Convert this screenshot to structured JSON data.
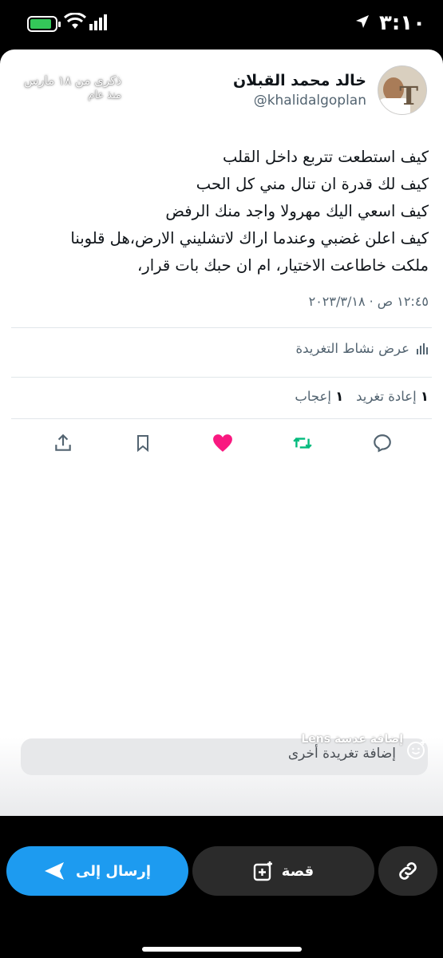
{
  "status_bar": {
    "time": "٣:١٠",
    "battery_color": "#34c759"
  },
  "memory": {
    "line1": "ذكرى من ١٨ مارس",
    "line2": "منذ عام"
  },
  "tweet": {
    "author_name": "خالد محمد القبلان",
    "author_handle": "@khalidalgoplan",
    "lines": [
      "كيف استطعت تتربع داخل القلب",
      "كيف لك قدرة ان تنال مني كل الحب",
      "كيف اسعي اليك مهرولا واجد منك الرفض",
      "كيف اعلن غضبي وعندما اراك لاتشليني الارض،هل قلوبنا",
      "ملكت خاطاعت الاختيار، ام ان حبك بات قرار،"
    ],
    "timestamp": "١٢:٤٥ ص · ٢٠٢٣/٣/١٨",
    "activity_label": "عرض نشاط التغريدة",
    "retweets_count": "١",
    "retweets_label": "إعادة تغريد",
    "likes_count": "١",
    "likes_label": "إعجاب",
    "like_color": "#f91880",
    "retweet_color": "#00ba7c"
  },
  "actions": [
    "reply-icon",
    "retweet-icon",
    "like-icon",
    "bookmark-icon",
    "share-icon"
  ],
  "composer": {
    "placeholder": "إضافة تغريدة أخرى",
    "lens_label": "إضافة عدسة Lens"
  },
  "share_bar": {
    "send_label": "إرسال إلى",
    "story_label": "قصة",
    "accent": "#1d9bf0"
  }
}
